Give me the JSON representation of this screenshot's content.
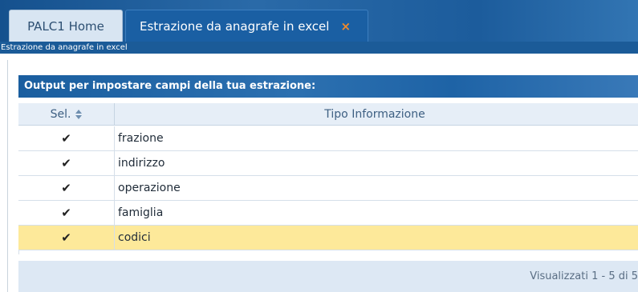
{
  "tabs": [
    {
      "label": "PALC1 Home",
      "active": false
    },
    {
      "label": "Estrazione da anagrafe in excel",
      "active": true,
      "close_icon": "close-icon"
    }
  ],
  "tab_close_symbol": "×",
  "breadcrumb": "Estrazione da anagrafe in excel",
  "grid": {
    "title": "Output per impostare campi della tua estrazione:",
    "columns": [
      "Sel.",
      "Tipo Informazione"
    ],
    "sort_icon": "sort-icon",
    "rows": [
      {
        "sel": "✔",
        "tipo": "frazione",
        "selected": false
      },
      {
        "sel": "✔",
        "tipo": "indirizzo",
        "selected": false
      },
      {
        "sel": "✔",
        "tipo": "operazione",
        "selected": false
      },
      {
        "sel": "✔",
        "tipo": "famiglia",
        "selected": false
      },
      {
        "sel": "✔",
        "tipo": "codici",
        "selected": true
      }
    ],
    "footer": "Visualizzati 1 - 5 di 5"
  },
  "colors": {
    "header_blue": "#1a5e9f",
    "selected_row": "#fde99a",
    "close_accent": "#f28a2a"
  }
}
